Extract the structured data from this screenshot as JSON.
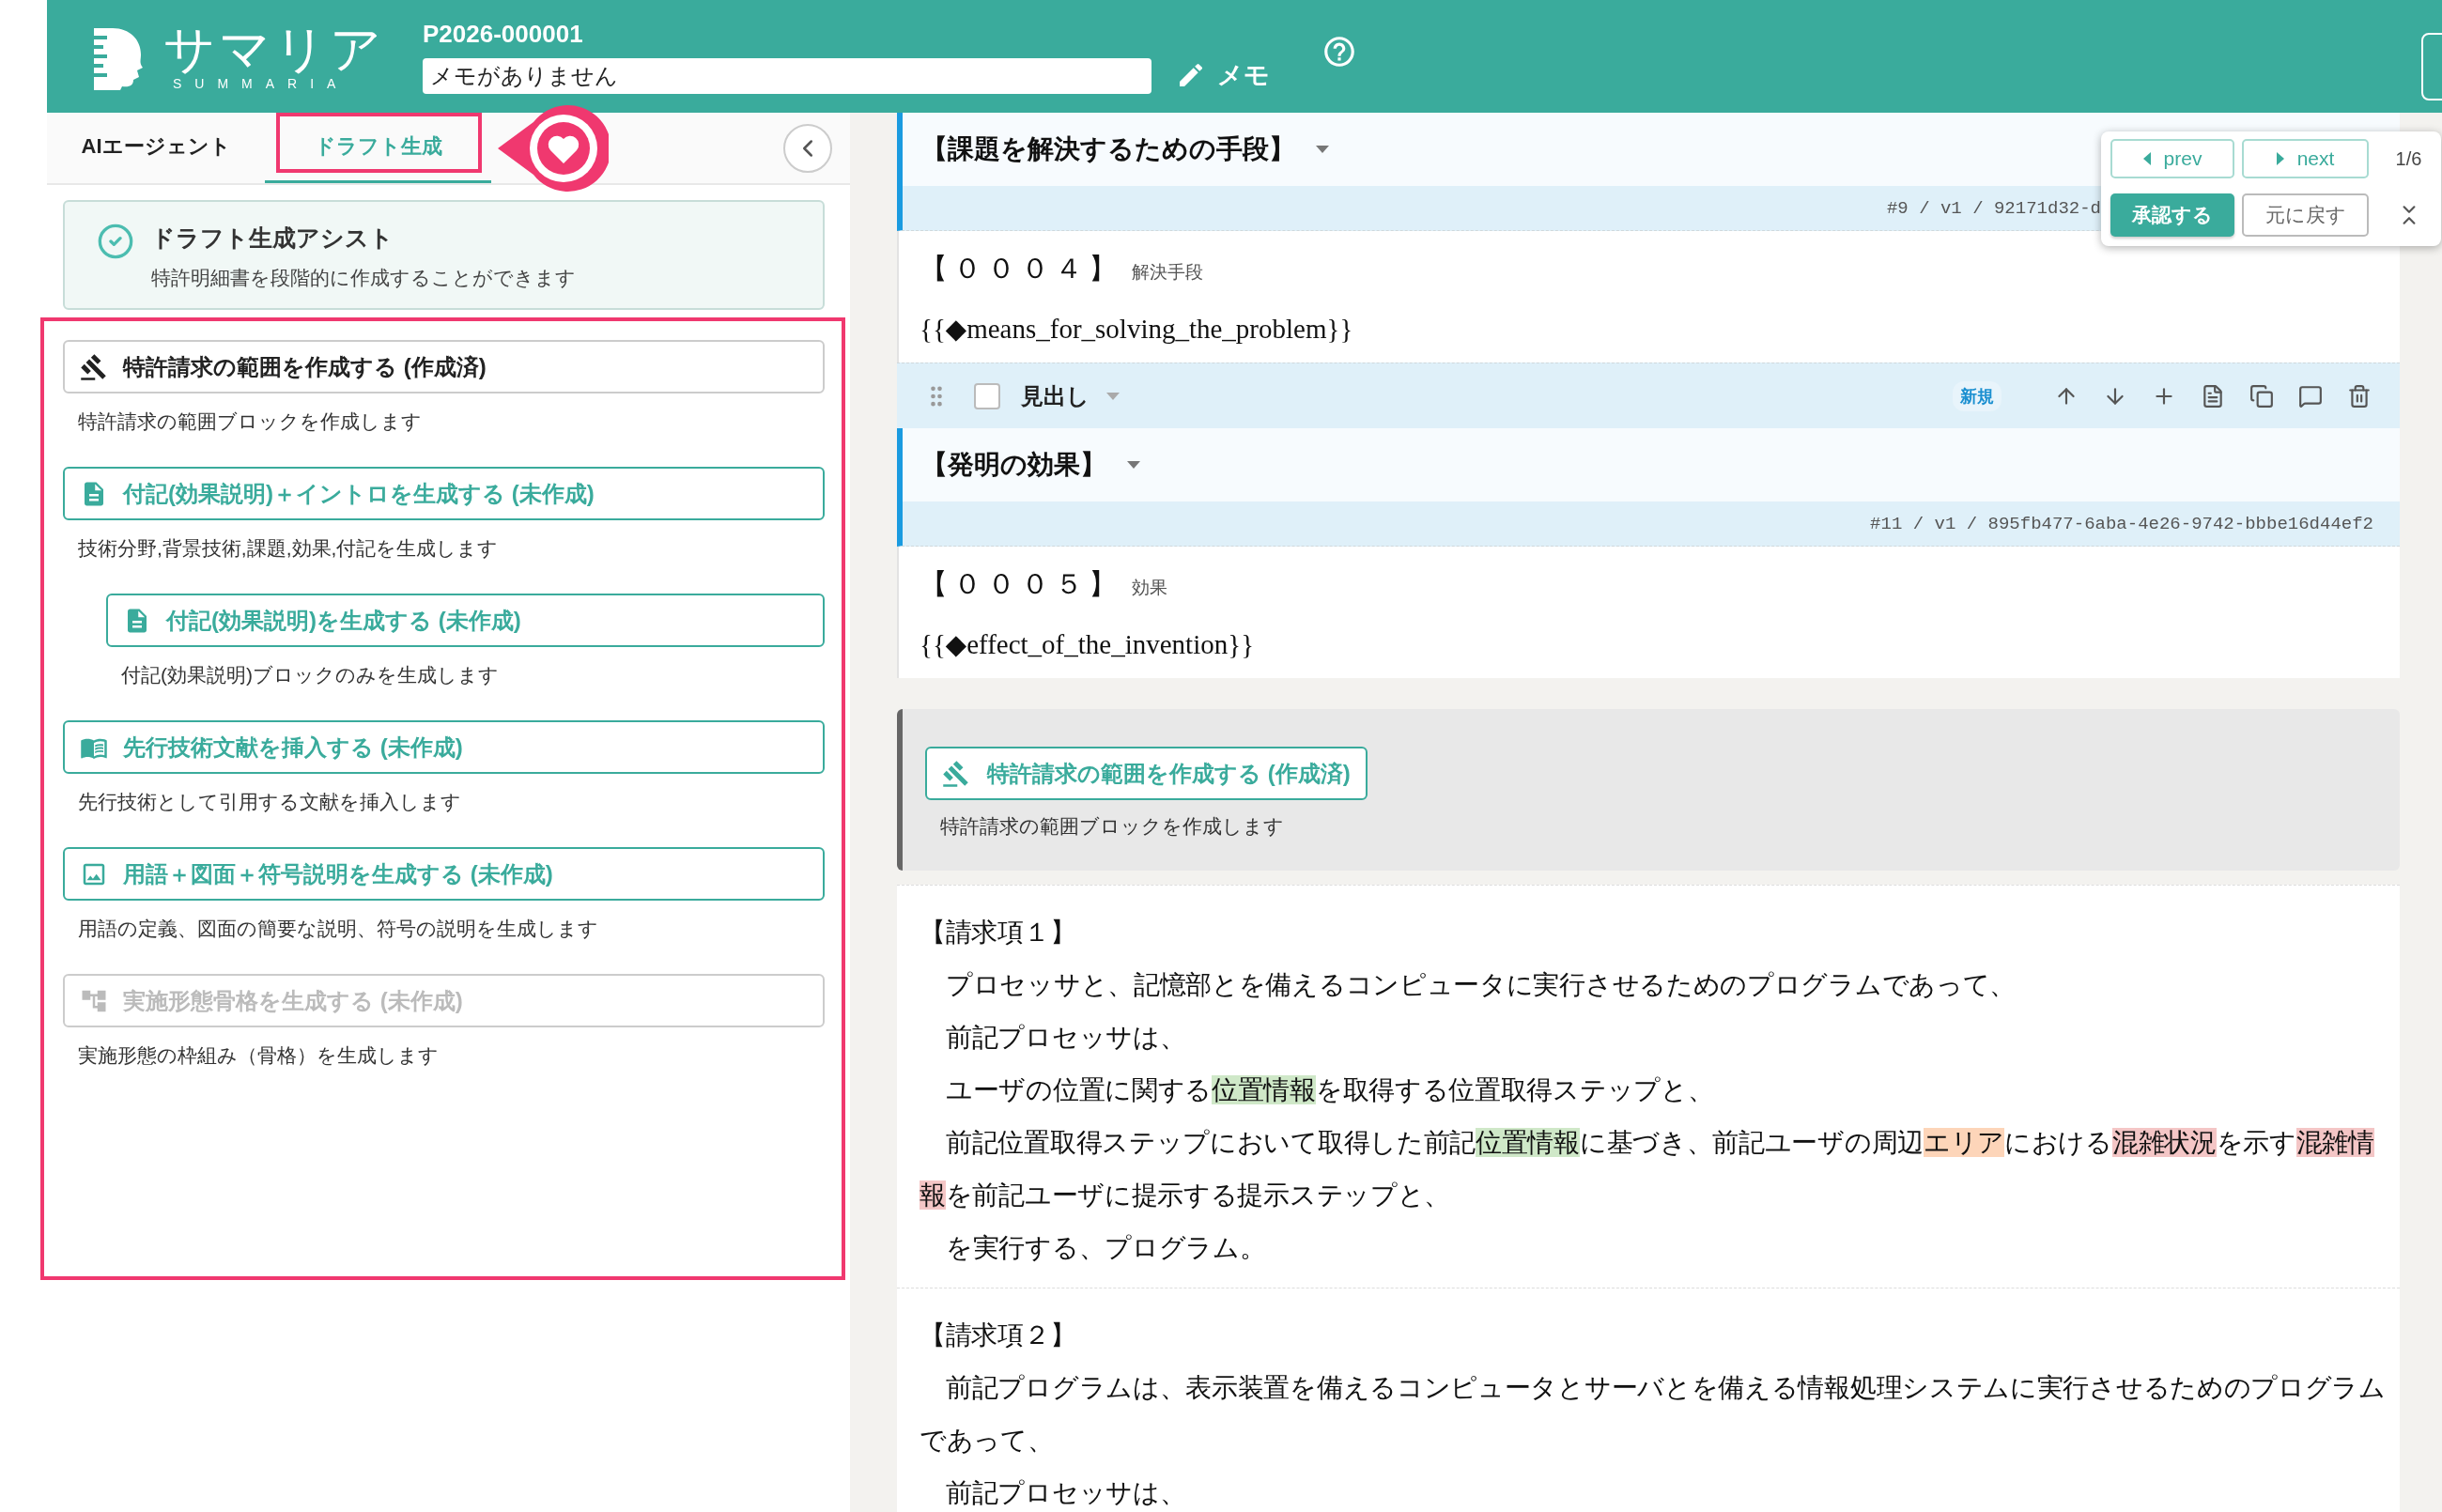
{
  "header": {
    "logo": {
      "name": "サマリア",
      "subtitle": "SUMMARIA"
    },
    "project_id": "P2026-000001",
    "memo": {
      "value": "メモがありません"
    },
    "memo_button": "メモ"
  },
  "left_panel": {
    "tabs": [
      {
        "label": "AIエージェント",
        "selected": false
      },
      {
        "label": "ドラフト生成",
        "selected": true
      }
    ],
    "assist_card": {
      "title": "ドラフト生成アシスト",
      "description": "特許明細書を段階的に作成することができます"
    },
    "actions": [
      {
        "label": "特許請求の範囲を作成する (作成済)",
        "description": "特許請求の範囲ブロックを作成します",
        "kind": "gavel",
        "completed": true,
        "disabled": false
      },
      {
        "label": "付記(効果説明)＋イントロを生成する (未作成)",
        "description": "技術分野,背景技術,課題,効果,付記を生成します",
        "kind": "doc",
        "completed": false,
        "disabled": false,
        "children": [
          {
            "label": "付記(効果説明)を生成する (未作成)",
            "description": "付記(効果説明)ブロックのみを生成します",
            "kind": "doc",
            "completed": false,
            "disabled": false
          }
        ]
      },
      {
        "label": "先行技術文献を挿入する (未作成)",
        "description": "先行技術として引用する文献を挿入します",
        "kind": "book",
        "completed": false,
        "disabled": false
      },
      {
        "label": "用語＋図面＋符号説明を生成する (未作成)",
        "description": "用語の定義、図面の簡要な説明、符号の説明を生成します",
        "kind": "image",
        "completed": false,
        "disabled": false
      },
      {
        "label": "実施形態骨格を生成する (未作成)",
        "description": "実施形態の枠組み（骨格）を生成します",
        "kind": "tree",
        "completed": false,
        "disabled": true
      }
    ]
  },
  "document": {
    "blocks": [
      {
        "kind": "heading",
        "text": "【課題を解決するための手段】"
      },
      {
        "kind": "meta",
        "text": "#9 / v1 / 92171d32-d",
        "cut": true
      },
      {
        "kind": "paragraph",
        "number": "【０００４】",
        "label": "解決手段",
        "body": "{{◆means_for_solving_the_problem}}"
      },
      {
        "kind": "toolbar",
        "checked": false,
        "style": "見出し",
        "badge": "新規"
      },
      {
        "kind": "heading",
        "text": "【発明の効果】"
      },
      {
        "kind": "meta",
        "text": "#11 / v1 / 895fb477-6aba-4e26-9742-bbbe16d44ef2",
        "cut": false
      },
      {
        "kind": "paragraph",
        "number": "【０００５】",
        "label": "効果",
        "body": "{{◆effect_of_the_invention}}"
      },
      {
        "kind": "action_card",
        "button": "特許請求の範囲を作成する (作成済)",
        "description": "特許請求の範囲ブロックを作成します"
      },
      {
        "kind": "claim",
        "title": "【請求項１】",
        "lines": [
          [
            {
              "text": "プロセッサと、記憶部とを備えるコンピュータに実行させるためのプログラムであって、"
            }
          ],
          [
            {
              "text": "前記プロセッサは、"
            }
          ],
          [
            {
              "text": "ユーザの位置に関する"
            },
            {
              "text": "位置情報",
              "color": "#cfe8c8"
            },
            {
              "text": "を取得する位置取得ステップと、"
            }
          ],
          [
            {
              "text": "前記位置取得ステップにおいて取得した前記"
            },
            {
              "text": "位置情報",
              "color": "#cfe8c8"
            },
            {
              "text": "に基づき、前記ユーザの周辺"
            },
            {
              "text": "エリア",
              "color": "#fdd5b9"
            },
            {
              "text": "における"
            },
            {
              "text": "混雑状況",
              "color": "#f4c6c6"
            },
            {
              "text": "を示す"
            },
            {
              "text": "混雑情報",
              "color": "#f4c6c6"
            },
            {
              "text": "を前記ユーザに提示する提示ステップと、"
            }
          ],
          [
            {
              "text": "を実行する、プログラム。"
            }
          ]
        ]
      },
      {
        "kind": "claim",
        "title": "【請求項２】",
        "lines": [
          [
            {
              "text": "前記プログラムは、表示装置を備えるコンピュータとサーバとを備える情報処理システムに実行させるためのプログラムであって、"
            }
          ],
          [
            {
              "text": "前記プロセッサは、"
            }
          ]
        ]
      }
    ]
  },
  "review_popover": {
    "prev": "prev",
    "next": "next",
    "counter": "1/6",
    "approve": "承認する",
    "revert": "元に戻す"
  }
}
